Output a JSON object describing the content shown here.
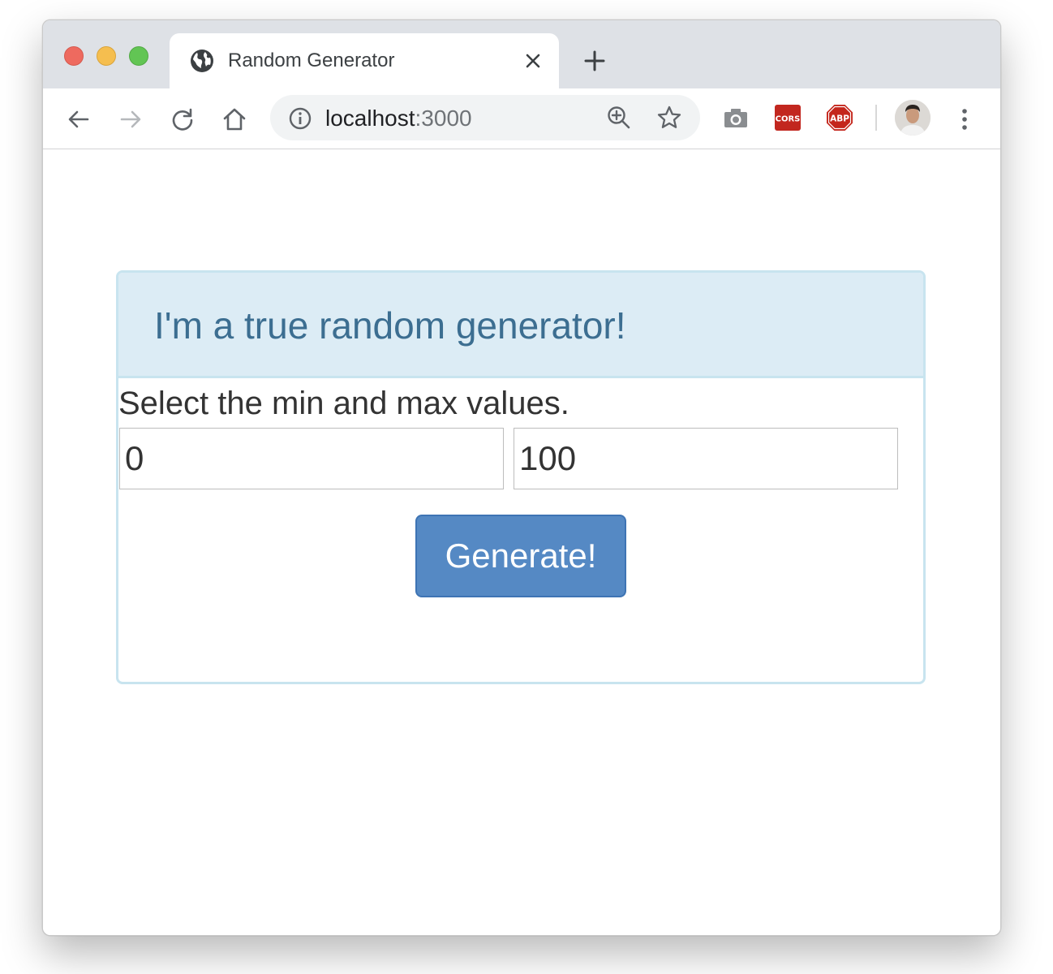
{
  "browser": {
    "tab": {
      "title": "Random Generator"
    },
    "address": {
      "host": "localhost",
      "port": ":3000"
    },
    "extensions": [
      "camera-icon",
      "cors-icon",
      "abp-icon"
    ],
    "extension_labels": {
      "cors": "CORS",
      "abp": "ABP"
    }
  },
  "page": {
    "title": "I'm a true random generator!",
    "instructions": "Select the min and max values.",
    "min_value": "0",
    "max_value": "100",
    "generate_label": "Generate!"
  },
  "colors": {
    "panel_heading_bg": "#dcecf5",
    "panel_title": "#3c6e91",
    "button_bg": "#5589c4"
  }
}
